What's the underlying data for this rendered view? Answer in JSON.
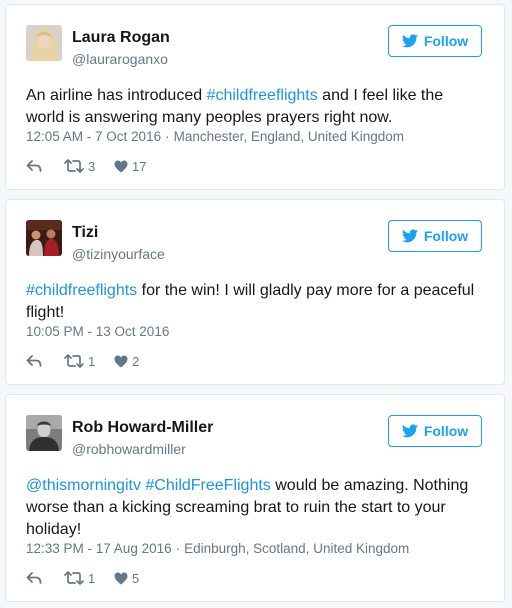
{
  "follow_label": "Follow",
  "colors": {
    "accent": "#1da1f2",
    "link": "#1b95e0",
    "muted": "#657786",
    "border": "#e1e8ed"
  },
  "icons": {
    "follow": "twitter-bird-icon",
    "reply": "reply-icon",
    "retweet": "retweet-icon",
    "like": "heart-icon"
  },
  "tweets": [
    {
      "name": "Laura Rogan",
      "handle": "@lauraroganxo",
      "text": [
        {
          "t": "An airline has introduced ",
          "k": "plain"
        },
        {
          "t": "#childfreeflights",
          "k": "hashtag"
        },
        {
          "t": " and I feel like the world is answering many peoples prayers right now.",
          "k": "plain"
        }
      ],
      "time": "12:05 AM - 7 Oct 2016",
      "location": "Manchester, England, United Kingdom",
      "retweets": "3",
      "likes": "17"
    },
    {
      "name": "Tizi",
      "handle": "@tizinyourface",
      "text": [
        {
          "t": "#childfreeflights",
          "k": "hashtag"
        },
        {
          "t": " for the win! I will gladly pay more for a peaceful flight!",
          "k": "plain"
        }
      ],
      "time": "10:05 PM - 13 Oct 2016",
      "location": "",
      "retweets": "1",
      "likes": "2"
    },
    {
      "name": "Rob Howard-Miller",
      "handle": "@robhowardmiller",
      "text": [
        {
          "t": "@thismorningitv",
          "k": "mention"
        },
        {
          "t": " ",
          "k": "plain"
        },
        {
          "t": "#ChildFreeFlights",
          "k": "hashtag"
        },
        {
          "t": " would be amazing. Nothing worse than a kicking screaming brat to ruin the start to your holiday!",
          "k": "plain"
        }
      ],
      "time": "12:33 PM - 17 Aug 2016",
      "location": "Edinburgh, Scotland, United Kingdom",
      "retweets": "1",
      "likes": "5"
    }
  ]
}
